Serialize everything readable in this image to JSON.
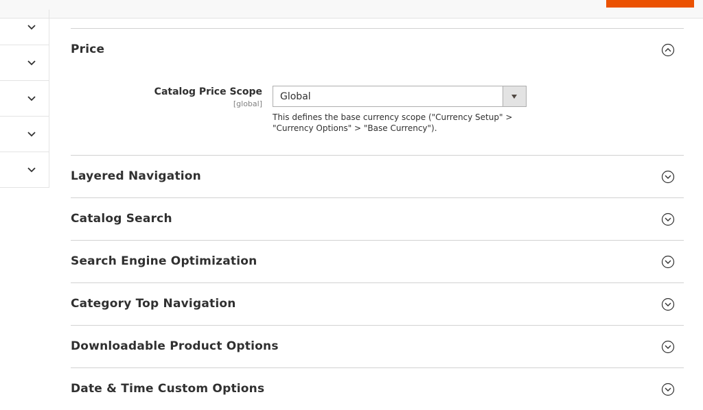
{
  "header": {
    "accent_color": "#eb5202"
  },
  "sidebar": {
    "items": [
      {
        "icon": "chevron-down-icon"
      },
      {
        "icon": "chevron-down-icon"
      },
      {
        "icon": "chevron-down-icon"
      },
      {
        "icon": "chevron-down-icon"
      },
      {
        "icon": "chevron-down-icon"
      }
    ]
  },
  "sections": {
    "price": {
      "title": "Price",
      "expanded": true,
      "field": {
        "label": "Catalog Price Scope",
        "scope": "[global]",
        "value": "Global",
        "note_line1": "This defines the base currency scope (\"Currency Setup\" >",
        "note_line2": "\"Currency Options\" > \"Base Currency\")."
      }
    },
    "layered_navigation": {
      "title": "Layered Navigation",
      "expanded": false
    },
    "catalog_search": {
      "title": "Catalog Search",
      "expanded": false
    },
    "seo": {
      "title": "Search Engine Optimization",
      "expanded": false
    },
    "category_top_navigation": {
      "title": "Category Top Navigation",
      "expanded": false
    },
    "downloadable_product_options": {
      "title": "Downloadable Product Options",
      "expanded": false
    },
    "date_time_custom_options": {
      "title": "Date & Time Custom Options",
      "expanded": false
    }
  }
}
